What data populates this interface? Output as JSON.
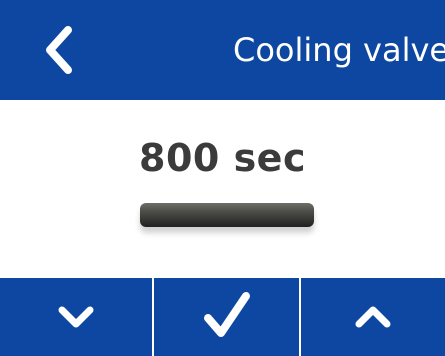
{
  "header": {
    "title": "Cooling valve",
    "back_icon": "chevron-left-icon"
  },
  "main": {
    "value": "800 sec",
    "progress_value_percent": 100
  },
  "footer": {
    "decrease_icon": "chevron-down-icon",
    "confirm_icon": "checkmark-icon",
    "increase_icon": "chevron-up-icon"
  },
  "colors": {
    "primary": "#0d47a1",
    "background": "#ffffff",
    "text": "#3b3b3b",
    "bar_dark": "#202020"
  }
}
